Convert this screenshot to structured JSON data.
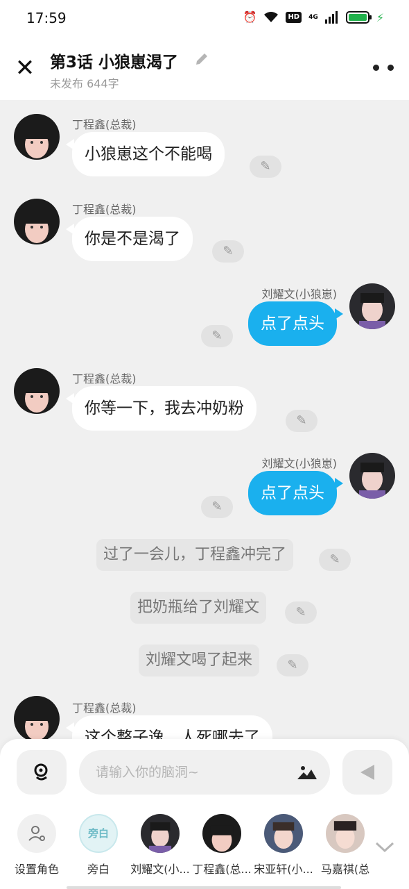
{
  "status_bar": {
    "time": "17:59",
    "hd": "HD",
    "network": "4G"
  },
  "header": {
    "title": "第3话  小狼崽渴了",
    "subtitle": "未发布 644字"
  },
  "messages": [
    {
      "kind": "left",
      "name": "丁程鑫(总裁)",
      "text": "小狼崽这个不能喝"
    },
    {
      "kind": "left",
      "name": "丁程鑫(总裁)",
      "text": "你是不是渴了"
    },
    {
      "kind": "right",
      "name": "刘耀文(小狼崽)",
      "text": "点了点头"
    },
    {
      "kind": "left",
      "name": "丁程鑫(总裁)",
      "text": "你等一下，我去冲奶粉"
    },
    {
      "kind": "right",
      "name": "刘耀文(小狼崽)",
      "text": "点了点头"
    },
    {
      "kind": "narration",
      "text": "过了一会儿，丁程鑫冲完了"
    },
    {
      "kind": "narration",
      "text": "把奶瓶给了刘耀文"
    },
    {
      "kind": "narration",
      "text": "刘耀文喝了起来"
    },
    {
      "kind": "left",
      "name": "丁程鑫(总裁)",
      "text": "这个整子逸，人死哪去了"
    }
  ],
  "composer": {
    "placeholder": "请输入你的脑洞~"
  },
  "roles": [
    {
      "label": "设置角色"
    },
    {
      "label": "旁白",
      "avatar_text": "旁白"
    },
    {
      "label": "刘耀文(小..."
    },
    {
      "label": "丁程鑫(总..."
    },
    {
      "label": "宋亚轩(小..."
    },
    {
      "label": "马嘉祺(总"
    }
  ],
  "colors": {
    "accent_blue": "#1ab0ee",
    "battery_green": "#22b14c",
    "background": "#f0f0f0"
  }
}
